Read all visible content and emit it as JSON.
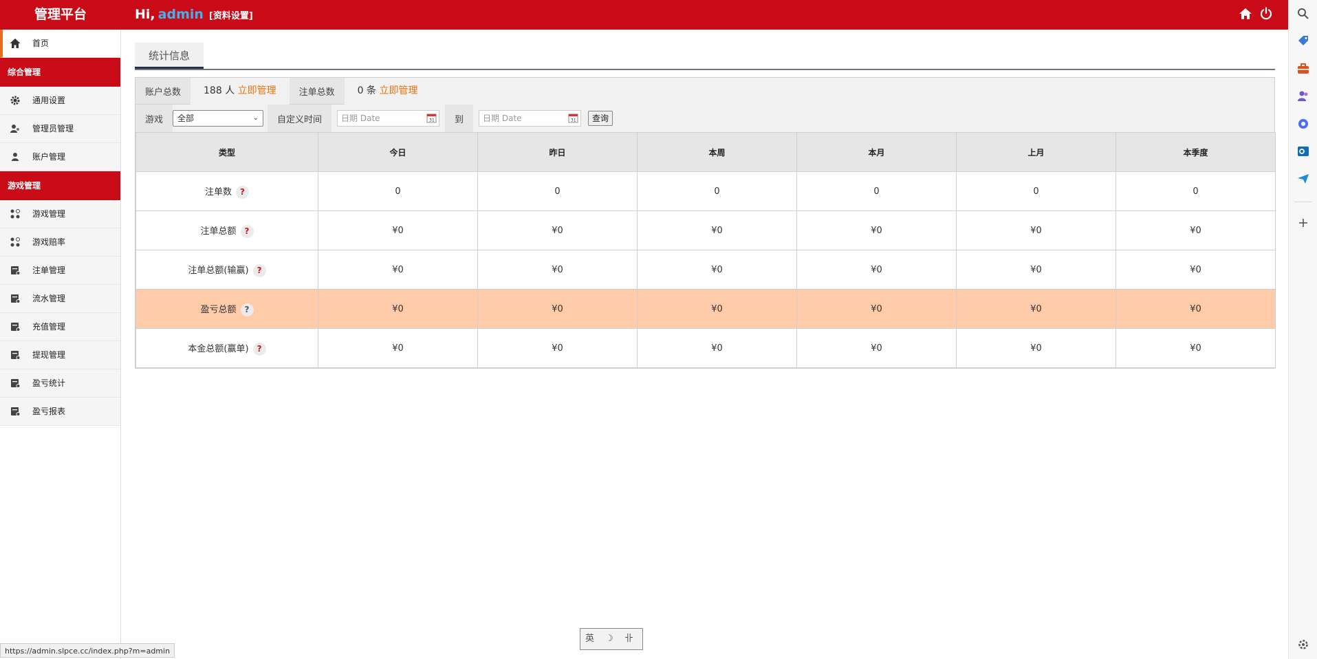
{
  "header": {
    "brand": "管理平台",
    "greeting": "Hi,",
    "username": "admin",
    "profile_link": "[资料设置]",
    "icons": [
      "home-icon",
      "power-icon"
    ]
  },
  "sidebar": {
    "home": "首页",
    "section_general": "综合管理",
    "general_items": [
      "通用设置",
      "管理员管理",
      "账户管理"
    ],
    "section_game": "游戏管理",
    "game_items": [
      "游戏管理",
      "游戏赔率",
      "注单管理",
      "流水管理",
      "充值管理",
      "提现管理",
      "盈亏统计",
      "盈亏报表"
    ]
  },
  "tab": {
    "label": "统计信息"
  },
  "summary": {
    "accounts_label": "账户总数",
    "accounts_value": "188 人",
    "accounts_link": "立即管理",
    "bets_label": "注单总数",
    "bets_value": "0 条",
    "bets_link": "立即管理"
  },
  "filter": {
    "game_label": "游戏",
    "game_selected": "全部",
    "custom_time_label": "自定义时间",
    "date_placeholder": "日期 Date",
    "to_label": "到",
    "query_button": "查询"
  },
  "table": {
    "headers": [
      "类型",
      "今日",
      "昨日",
      "本周",
      "本月",
      "上月",
      "本季度"
    ],
    "rows": [
      {
        "label": "注单数",
        "values": [
          "0",
          "0",
          "0",
          "0",
          "0",
          "0"
        ]
      },
      {
        "label": "注单总额",
        "values": [
          "¥0",
          "¥0",
          "¥0",
          "¥0",
          "¥0",
          "¥0"
        ]
      },
      {
        "label": "注单总额(输赢)",
        "values": [
          "¥0",
          "¥0",
          "¥0",
          "¥0",
          "¥0",
          "¥0"
        ]
      },
      {
        "label": "盈亏总额",
        "values": [
          "¥0",
          "¥0",
          "¥0",
          "¥0",
          "¥0",
          "¥0"
        ]
      },
      {
        "label": "本金总额(赢单)",
        "values": [
          "¥0",
          "¥0",
          "¥0",
          "¥0",
          "¥0",
          "¥0"
        ]
      }
    ],
    "help_glyph": "?"
  },
  "status_bar": {
    "url": "https://admin.slpce.cc/index.php?m=admin"
  },
  "ime": {
    "text": "英 ☽ 卝"
  },
  "colors": {
    "brand_red": "#c90a17",
    "accent_orange": "#e8730f",
    "highlight_row": "#ffcba9",
    "username_blue": "#3fb2f0"
  }
}
